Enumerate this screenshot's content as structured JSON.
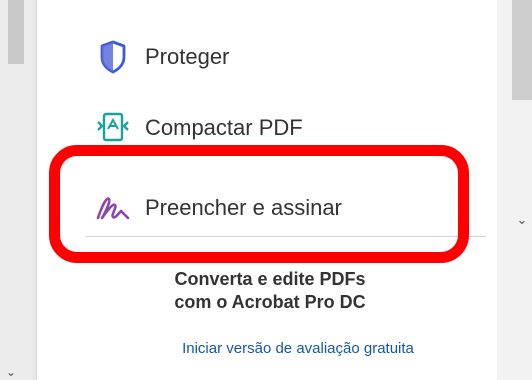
{
  "tools": [
    {
      "icon": "shield-icon",
      "label": "Proteger"
    },
    {
      "icon": "compress-pdf-icon",
      "label": "Compactar PDF"
    },
    {
      "icon": "fill-sign-icon",
      "label": "Preencher e assinar"
    }
  ],
  "promo": {
    "line1": "Converta e edite PDFs",
    "line2": "com o Acrobat Pro DC",
    "trial_link": "Iniciar versão de avaliação gratuita"
  },
  "scroll": {
    "right_chevron": "⌄",
    "left_chevron": "⌄"
  },
  "colors": {
    "highlight": "#ff0000",
    "link": "#1558a6",
    "shield_icon": "#3b5bdb",
    "compress_icon": "#18a49b",
    "fill_sign_icon": "#8e44ad"
  }
}
